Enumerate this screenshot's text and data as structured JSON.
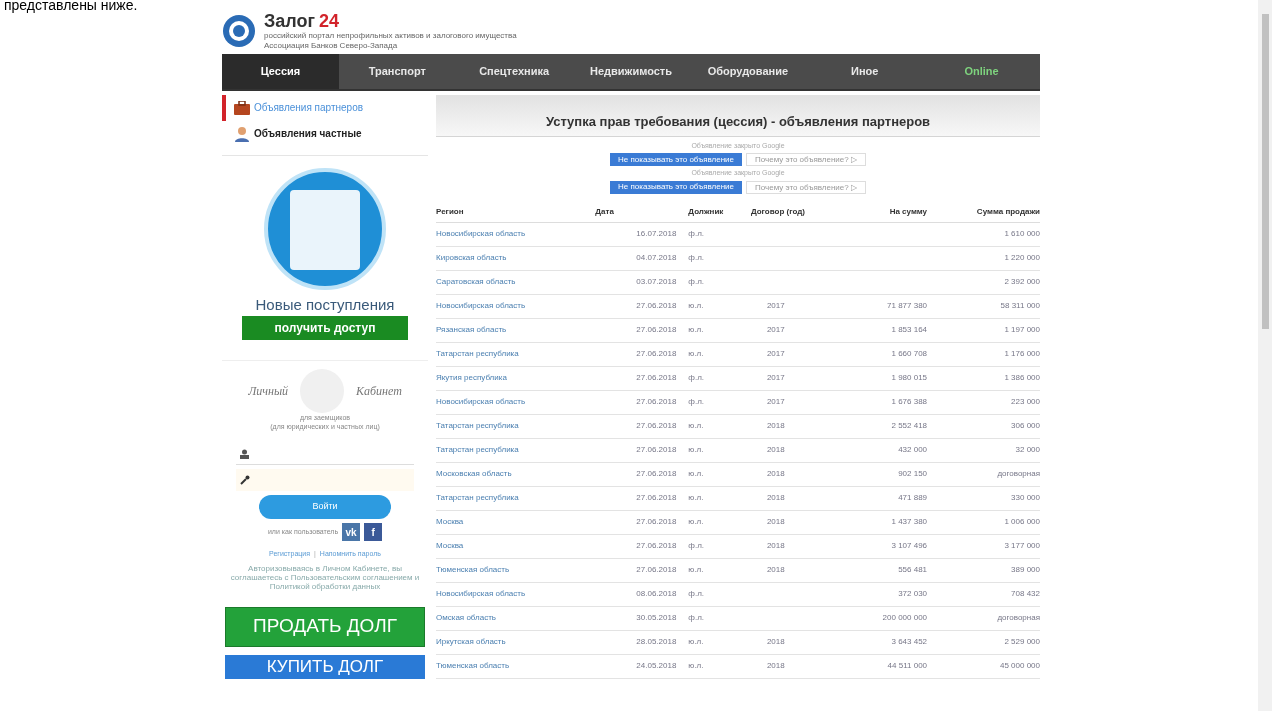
{
  "intro_text": "представлены ниже.",
  "header": {
    "logo_text": "Залог",
    "logo_number": "24",
    "tagline": "российский портал непрофильных активов и залогового имущества",
    "association": "Ассоциация Банков Северо-Запада"
  },
  "nav": [
    {
      "label": "Цессия",
      "selected": true,
      "kind": "normal"
    },
    {
      "label": "Транспорт",
      "selected": false,
      "kind": "normal"
    },
    {
      "label": "Спецтехника",
      "selected": false,
      "kind": "normal"
    },
    {
      "label": "Недвижимость",
      "selected": false,
      "kind": "normal"
    },
    {
      "label": "Оборудование",
      "selected": false,
      "kind": "normal"
    },
    {
      "label": "Иное",
      "selected": false,
      "kind": "normal"
    },
    {
      "label": "Online",
      "selected": false,
      "kind": "online"
    }
  ],
  "sidebar": {
    "listings": [
      {
        "label": "Объявления партнеров",
        "selected": true,
        "kind": "briefcase"
      },
      {
        "label": "Объявления частные",
        "selected": false,
        "kind": "person"
      }
    ],
    "promo_title": "Новые поступления",
    "promo_button": "получить доступ",
    "cabinet_left": "Личный",
    "cabinet_right": "Кабинет",
    "cabinet_note": [
      "для заемщиков",
      "(для юридических и частных лиц)"
    ],
    "login_button": "Войти",
    "social_text": "или как пользователь",
    "social": [
      {
        "label": "vk",
        "color": "#4a76a8"
      },
      {
        "label": "f",
        "color": "#3b5998"
      }
    ],
    "links": [
      "Регистрация",
      "Напомнить пароль"
    ],
    "links_separator": "|",
    "consent": "Авторизовываясь в Личном Кабинете, вы соглашаетесь с Пользовательским соглашением и Политикой обработки данных",
    "sell_button": "ПРОДАТЬ ДОЛГ",
    "buy_button": "КУПИТЬ ДОЛГ"
  },
  "main": {
    "title": "Уступка прав требования (цессия) - объявления партнеров",
    "ads": [
      {
        "notice": "Объявление закрыто Google",
        "hide_button": "Не показывать это объявление",
        "why_button": "Почему это объявление? ▷"
      },
      {
        "notice": "Объявление закрыто Google",
        "hide_button": "Не показывать это объявление",
        "why_button": "Почему это объявление? ▷"
      }
    ],
    "table": {
      "columns": [
        "Регион",
        "Дата",
        "Должник",
        "Договор (год)",
        "На сумму",
        "Сумма продажи"
      ],
      "rows": [
        [
          "Новосибирская область",
          "16.07.2018",
          "ф.л.",
          "",
          "",
          "1 610 000"
        ],
        [
          "Кировская область",
          "04.07.2018",
          "ф.л.",
          "",
          "",
          "1 220 000"
        ],
        [
          "Саратовская область",
          "03.07.2018",
          "ф.л.",
          "",
          "",
          "2 392 000"
        ],
        [
          "Новосибирская область",
          "27.06.2018",
          "ю.л.",
          "2017",
          "71 877 380",
          "58 311 000"
        ],
        [
          "Рязанская область",
          "27.06.2018",
          "ю.л.",
          "2017",
          "1 853 164",
          "1 197 000"
        ],
        [
          "Татарстан республика",
          "27.06.2018",
          "ю.л.",
          "2017",
          "1 660 708",
          "1 176 000"
        ],
        [
          "Якутия республика",
          "27.06.2018",
          "ф.л.",
          "2017",
          "1 980 015",
          "1 386 000"
        ],
        [
          "Новосибирская область",
          "27.06.2018",
          "ф.л.",
          "2017",
          "1 676 388",
          "223 000"
        ],
        [
          "Татарстан республика",
          "27.06.2018",
          "ю.л.",
          "2018",
          "2 552 418",
          "306 000"
        ],
        [
          "Татарстан республика",
          "27.06.2018",
          "ю.л.",
          "2018",
          "432 000",
          "32 000"
        ],
        [
          "Московская область",
          "27.06.2018",
          "ю.л.",
          "2018",
          "902 150",
          "договорная"
        ],
        [
          "Татарстан республика",
          "27.06.2018",
          "ю.л.",
          "2018",
          "471 889",
          "330 000"
        ],
        [
          "Москва",
          "27.06.2018",
          "ю.л.",
          "2018",
          "1 437 380",
          "1 006 000"
        ],
        [
          "Москва",
          "27.06.2018",
          "ф.л.",
          "2018",
          "3 107 496",
          "3 177 000"
        ],
        [
          "Тюменская область",
          "27.06.2018",
          "ю.л.",
          "2018",
          "556 481",
          "389 000"
        ],
        [
          "Новосибирская область",
          "08.06.2018",
          "ф.л.",
          "",
          "372 030",
          "708 432"
        ],
        [
          "Омская область",
          "30.05.2018",
          "ф.л.",
          "",
          "200 000 000",
          "договорная"
        ],
        [
          "Иркутская область",
          "28.05.2018",
          "ю.л.",
          "2018",
          "3 643 452",
          "2 529 000"
        ],
        [
          "Тюменская область",
          "24.05.2018",
          "ю.л.",
          "2018",
          "44 511 000",
          "45 000 000"
        ]
      ]
    }
  }
}
